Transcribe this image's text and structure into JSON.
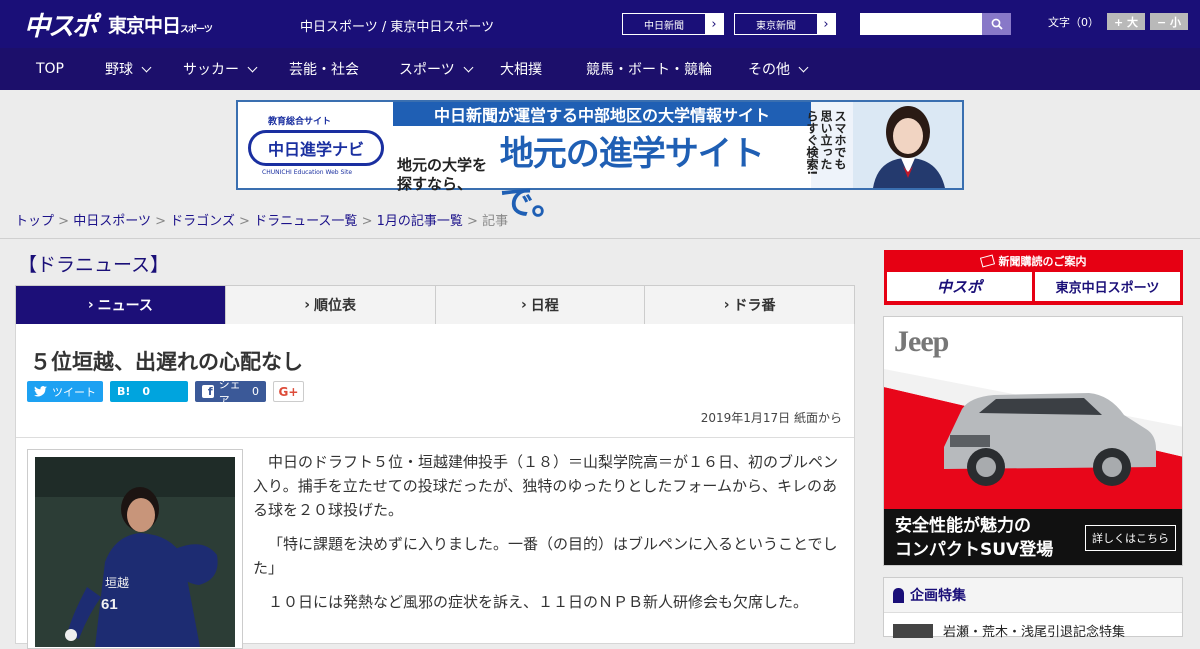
{
  "header": {
    "logo_main": "中スポ",
    "logo_sub": "東京中日",
    "logo_sub_small": "スポーツ",
    "site_name": "中日スポーツ / 東京中日スポーツ",
    "paper_links": [
      {
        "label": "中日新聞",
        "arrow": "›"
      },
      {
        "label": "東京新聞",
        "arrow": "›"
      }
    ],
    "search_placeholder": "",
    "font_label": "文字（0）",
    "font_bigger": "+ 大",
    "font_smaller": "− 小"
  },
  "nav": [
    {
      "label": "TOP",
      "has_menu": false
    },
    {
      "label": "野球",
      "has_menu": true
    },
    {
      "label": "サッカー",
      "has_menu": true
    },
    {
      "label": "芸能・社会",
      "has_menu": false
    },
    {
      "label": "スポーツ",
      "has_menu": true
    },
    {
      "label": "大相撲",
      "has_menu": false
    },
    {
      "label": "競馬・ボート・競輪",
      "has_menu": false
    },
    {
      "label": "その他",
      "has_menu": true
    }
  ],
  "ad_banner": {
    "small_label": "教育総合サイト",
    "logo": "中日進学ナビ",
    "logo_en": "CHUNICHI Education Web Site",
    "headline": "中日新聞が運営する中部地区の大学情報サイト",
    "sub": "地元の大学を探すなら、",
    "big": "地元の進学サイトで。",
    "vertical": "スマホでも思い立ったらすぐ検索!"
  },
  "breadcrumb": [
    {
      "label": "トップ",
      "link": true
    },
    {
      "label": "中日スポーツ",
      "link": true
    },
    {
      "label": "ドラゴンズ",
      "link": true
    },
    {
      "label": "ドラニュース一覧",
      "link": true
    },
    {
      "label": "1月の記事一覧",
      "link": true
    },
    {
      "label": "記事",
      "link": false
    }
  ],
  "breadcrumb_sep": ">",
  "section_title": "【ドラニュース】",
  "tabs": [
    {
      "label": "ニュース",
      "active": true
    },
    {
      "label": "順位表",
      "active": false
    },
    {
      "label": "日程",
      "active": false
    },
    {
      "label": "ドラ番",
      "active": false
    }
  ],
  "article": {
    "title": "５位垣越、出遅れの心配なし",
    "social": {
      "tweet": "ツイート",
      "hatena_icon": "B!",
      "hatena_count": "0",
      "fb_label": "シェア",
      "fb_count": "0",
      "gplus": "G+"
    },
    "date": "2019年1月17日 紙面から",
    "paragraphs": [
      "中日のドラフト５位・垣越建伸投手（１８）＝山梨学院高＝が１６日、初のブルペン入り。捕手を立たせての投球だったが、独特のゆったりとしたフォームから、キレのある球を２０球投げた。",
      "「特に課題を決めずに入りました。一番（の目的）はブルペンに入るということでした」",
      "１０日には発熱など風邪の症状を訴え、１１日のＮＰＢ新人研修会も欠席した。"
    ]
  },
  "sidebar": {
    "subscribe_title": "新聞購読のご案内",
    "subscribe_buttons": [
      "中スポ",
      "東京中日スポーツ"
    ],
    "jeep_ad": {
      "brand": "Jeep",
      "line1": "安全性能が魅力の",
      "line2": "コンパクトSUV登場",
      "cta": "詳しくはこちら"
    },
    "feature_title": "企画特集",
    "feature_item": "岩瀬・荒木・浅尾引退記念特集"
  },
  "colors": {
    "header_bg": "#1a0f78",
    "nav_bg": "#1c0f6b",
    "accent": "#1c0f78",
    "twitter": "#1da1f2",
    "hatena": "#00a4de",
    "facebook": "#3b5998",
    "subscribe_red": "#e60013"
  }
}
